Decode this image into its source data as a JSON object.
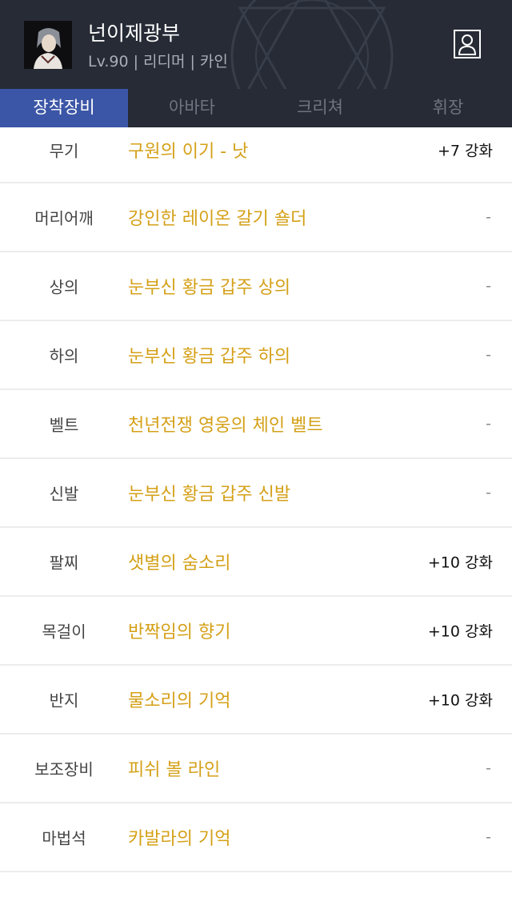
{
  "header": {
    "character_name": "넌이제광부",
    "level": "Lv.90",
    "job": "리디머",
    "server": "카인",
    "separator": "|"
  },
  "tabs": [
    {
      "label": "장착장비",
      "active": true
    },
    {
      "label": "아바타",
      "active": false
    },
    {
      "label": "크리쳐",
      "active": false
    },
    {
      "label": "휘장",
      "active": false
    }
  ],
  "equipment": [
    {
      "slot": "무기",
      "item": "구원의 이기 - 낫",
      "enhance": "+7 강화"
    },
    {
      "slot": "머리어깨",
      "item": "강인한 레이온 갈기 숄더",
      "enhance": "-"
    },
    {
      "slot": "상의",
      "item": "눈부신 황금 갑주 상의",
      "enhance": "-"
    },
    {
      "slot": "하의",
      "item": "눈부신 황금 갑주 하의",
      "enhance": "-"
    },
    {
      "slot": "벨트",
      "item": "천년전쟁 영웅의 체인 벨트",
      "enhance": "-"
    },
    {
      "slot": "신발",
      "item": "눈부신 황금 갑주 신발",
      "enhance": "-"
    },
    {
      "slot": "팔찌",
      "item": "샛별의 숨소리",
      "enhance": "+10 강화"
    },
    {
      "slot": "목걸이",
      "item": "반짝임의 향기",
      "enhance": "+10 강화"
    },
    {
      "slot": "반지",
      "item": "물소리의 기억",
      "enhance": "+10 강화"
    },
    {
      "slot": "보조장비",
      "item": "피쉬 볼 라인",
      "enhance": "-"
    },
    {
      "slot": "마법석",
      "item": "카발라의 기억",
      "enhance": "-"
    }
  ],
  "colors": {
    "header_bg": "#262b36",
    "active_tab": "#3b56a6",
    "item_name": "#d4a017"
  },
  "icons": {
    "avatar": "character-portrait",
    "profile_button": "profile-icon"
  }
}
